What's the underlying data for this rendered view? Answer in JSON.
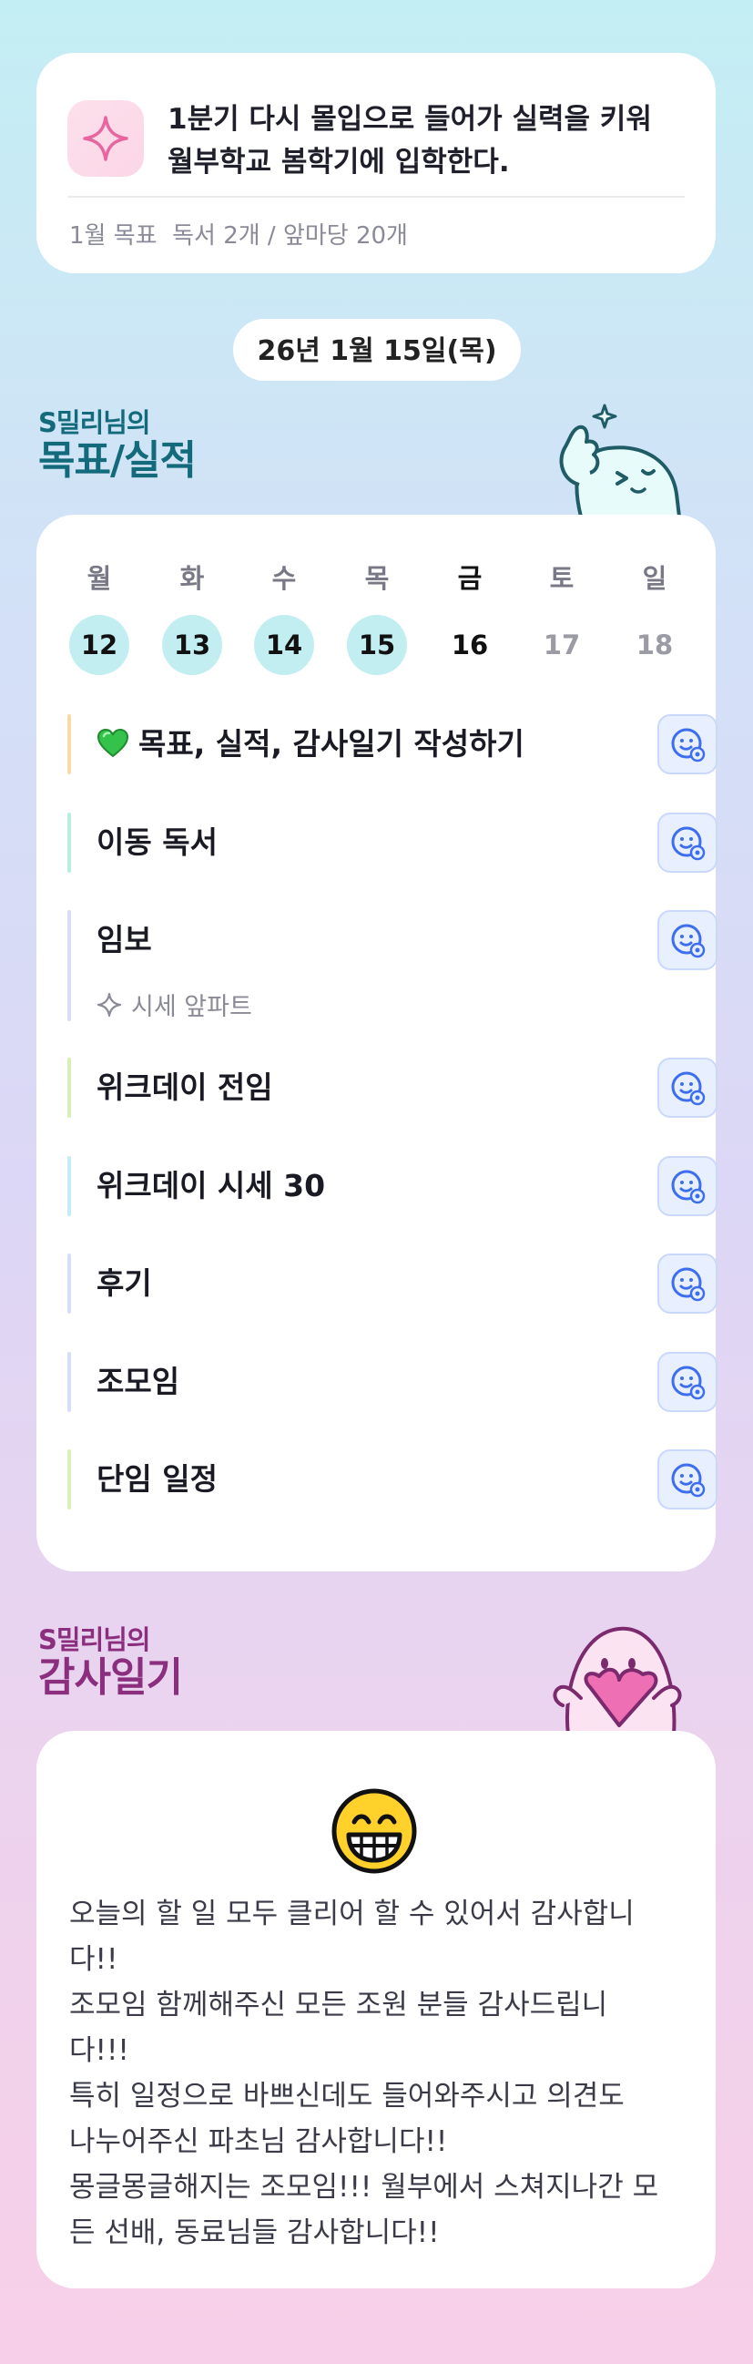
{
  "goal_card": {
    "main_goal_lines": [
      "1분기 다시 몰입으로 들어가 실력을 키워",
      "월부학교 봄학기에 입학한다."
    ],
    "monthly_goal": "1월 목표  독서 2개 / 앞마당 20개"
  },
  "date_pill": "26년 1월 15일(목)",
  "goals_section": {
    "subtitle": "S밀리님의",
    "title": "목표/실적"
  },
  "week": [
    {
      "day": "월",
      "date": "12",
      "state": "done"
    },
    {
      "day": "화",
      "date": "13",
      "state": "done"
    },
    {
      "day": "수",
      "date": "14",
      "state": "done"
    },
    {
      "day": "목",
      "date": "15",
      "state": "done"
    },
    {
      "day": "금",
      "date": "16",
      "state": "today"
    },
    {
      "day": "토",
      "date": "17",
      "state": "future"
    },
    {
      "day": "일",
      "date": "18",
      "state": "future"
    }
  ],
  "tasks": [
    {
      "label": "목표, 실적, 감사일기 작성하기",
      "icon": "green-heart-icon",
      "bar_color": "#f6dca4"
    },
    {
      "label": "이동 독서",
      "bar_color": "#b7eee0"
    },
    {
      "label": "임보",
      "bar_color": "#d8def7",
      "sub": "시세 앞파트",
      "sub_icon": "sparkle-icon"
    },
    {
      "label": "위크데이 전임",
      "bar_color": "#d7f0b6"
    },
    {
      "label": "위크데이 시세 30",
      "bar_color": "#c4eef7"
    },
    {
      "label": "후기",
      "bar_color": "#d7def7"
    },
    {
      "label": "조모임",
      "bar_color": "#d7def7"
    },
    {
      "label": "단임 일정",
      "bar_color": "#d6f2b6"
    }
  ],
  "gratitude_section": {
    "subtitle": "S밀리님의",
    "title": "감사일기"
  },
  "gratitude_card": {
    "emoji": "grinning-face-icon",
    "lines": [
      "오늘의 할 일 모두 클리어 할 수 있어서 감사합니",
      "다!!",
      "조모임 함께해주신 모든 조원 분들 감사드립니",
      "다!!!",
      "특히 일정으로 바쁘신데도 들어와주시고 의견도",
      "나누어주신 파초님 감사합니다!!",
      "몽글몽글해지는 조모임!!! 월부에서 스쳐지나간 모",
      "든 선배, 동료님들 감사합니다!!"
    ]
  },
  "colors": {
    "accent_teal": "#126a7b",
    "accent_purple": "#8b2e7d",
    "done_circle": "#c2eef2",
    "task_button": "#e8efff",
    "task_button_icon": "#3d6ef0"
  }
}
